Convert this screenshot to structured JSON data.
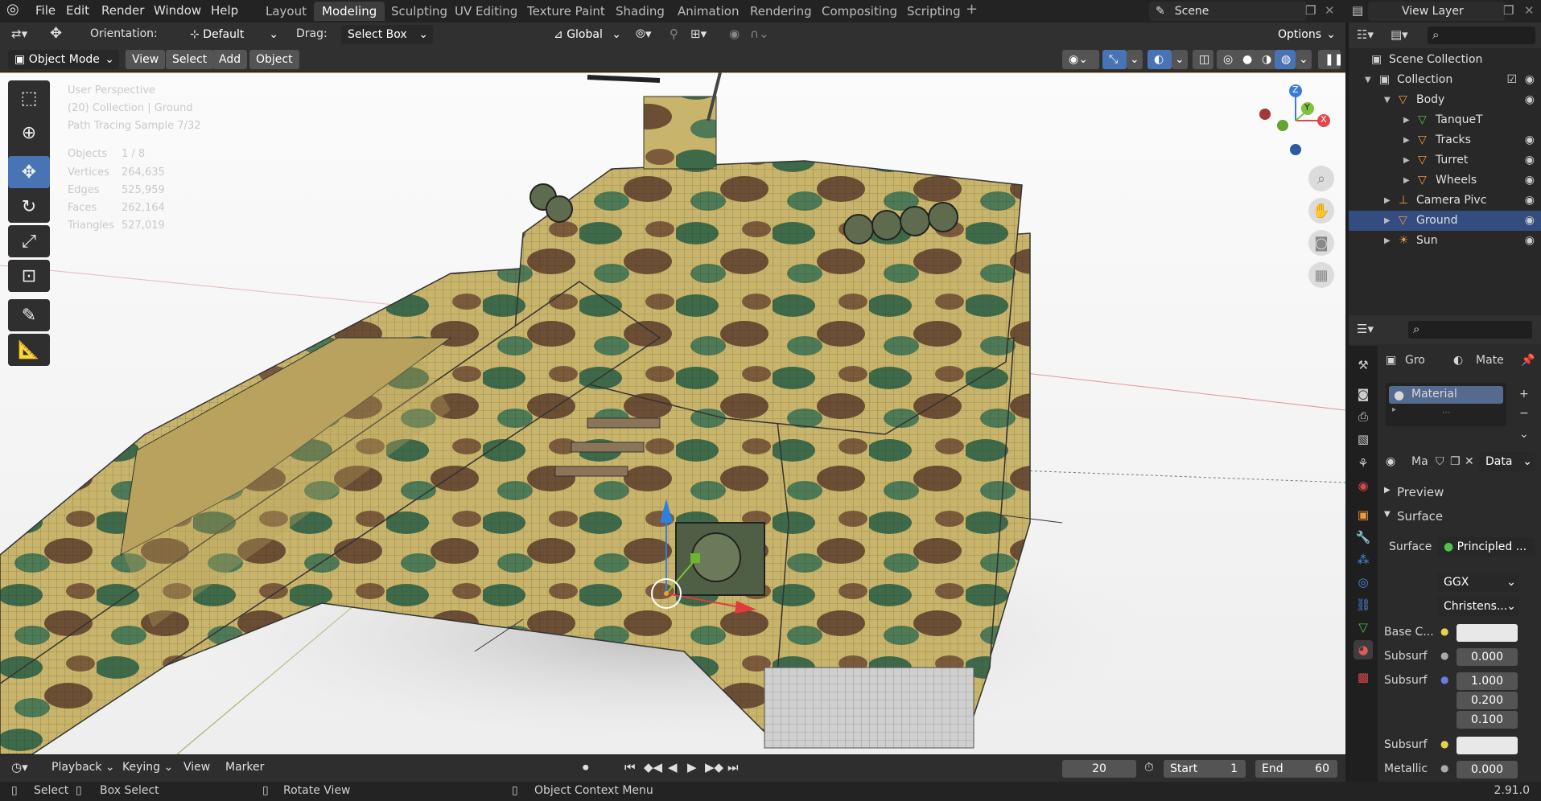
{
  "app": {
    "version": "2.91.0"
  },
  "menu": [
    "File",
    "Edit",
    "Render",
    "Window",
    "Help"
  ],
  "workspaces": [
    "Layout",
    "Modeling",
    "Sculpting",
    "UV Editing",
    "Texture Paint",
    "Shading",
    "Animation",
    "Rendering",
    "Compositing",
    "Scripting"
  ],
  "active_workspace": "Modeling",
  "scene": {
    "label": "Scene"
  },
  "view_layer": {
    "label": "View Layer"
  },
  "toolheader": {
    "orientation_label": "Orientation:",
    "orientation_value": "Default",
    "drag_label": "Drag:",
    "drag_value": "Select Box",
    "transform_orientation": "Global",
    "options_label": "Options"
  },
  "viewport_header": {
    "mode": "Object Mode",
    "view": "View",
    "select": "Select",
    "add": "Add",
    "object": "Object"
  },
  "overlay": {
    "line1": "User Perspective",
    "line2": "(20) Collection | Ground",
    "line3": "Path Tracing Sample 7/32",
    "stats": [
      {
        "label": "Objects",
        "value": "1 / 8"
      },
      {
        "label": "Vertices",
        "value": "264,635"
      },
      {
        "label": "Edges",
        "value": "525,959"
      },
      {
        "label": "Faces",
        "value": "262,164"
      },
      {
        "label": "Triangles",
        "value": "527,019"
      }
    ]
  },
  "gizmo": {
    "x": "X",
    "y": "Y",
    "z": "Z"
  },
  "timeline": {
    "playback": "Playback",
    "keying": "Keying",
    "view": "View",
    "marker": "Marker",
    "current_frame": "20",
    "start_label": "Start",
    "start": "1",
    "end_label": "End",
    "end": "60"
  },
  "statusbar": {
    "select": "Select",
    "box_select": "Box Select",
    "rotate_view": "Rotate View",
    "context_menu": "Object Context Menu"
  },
  "outliner": {
    "root": "Scene Collection",
    "items": [
      {
        "label": "Collection",
        "indent": 1
      },
      {
        "label": "Body",
        "indent": 2
      },
      {
        "label": "TanqueT",
        "indent": 3
      },
      {
        "label": "Tracks",
        "indent": 3
      },
      {
        "label": "Turret",
        "indent": 3
      },
      {
        "label": "Wheels",
        "indent": 3
      },
      {
        "label": "Camera Pivc",
        "indent": 2
      },
      {
        "label": "Ground",
        "indent": 2
      },
      {
        "label": "Sun",
        "indent": 2
      }
    ],
    "selected": "Ground"
  },
  "properties": {
    "crumb_object": "Gro",
    "crumb_material": "Mate",
    "slot_name": "Material",
    "mat_short": "Ma",
    "data_label": "Data",
    "preview": "Preview",
    "surface_panel": "Surface",
    "surface_label": "Surface",
    "surface_value": "Principled ...",
    "distribution": "GGX",
    "subsurface_method": "Christens...",
    "rows": [
      {
        "label": "Base C...",
        "value": ""
      },
      {
        "label": "Subsurf",
        "value": "0.000"
      },
      {
        "label": "Subsurf",
        "value": "1.000"
      },
      {
        "label": "",
        "value": "0.200"
      },
      {
        "label": "",
        "value": "0.100"
      },
      {
        "label": "Subsurf",
        "value": ""
      },
      {
        "label": "Metallic",
        "value": "0.000"
      }
    ]
  }
}
